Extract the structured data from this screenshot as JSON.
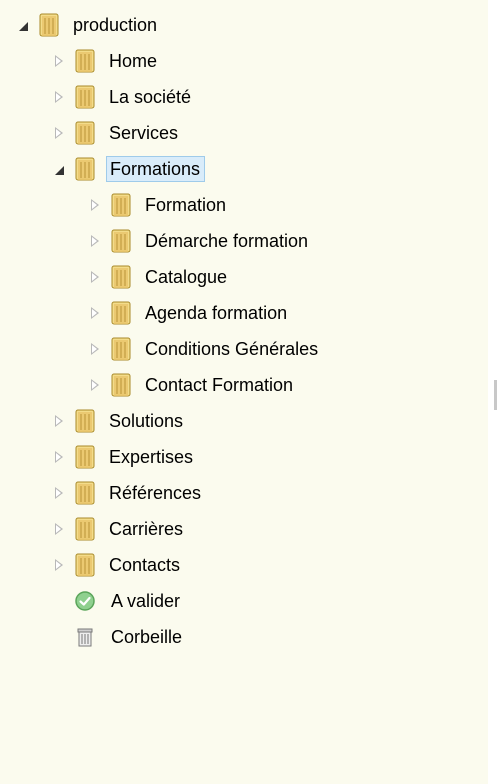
{
  "tree": {
    "root": {
      "label": "production",
      "state": "expanded"
    },
    "items": [
      {
        "label": "Home",
        "state": "collapsed"
      },
      {
        "label": "La société",
        "state": "collapsed"
      },
      {
        "label": "Services",
        "state": "collapsed"
      },
      {
        "label": "Formations",
        "state": "expanded",
        "selected": true,
        "children": [
          {
            "label": "Formation",
            "state": "collapsed"
          },
          {
            "label": "Démarche formation",
            "state": "collapsed"
          },
          {
            "label": "Catalogue",
            "state": "collapsed"
          },
          {
            "label": "Agenda formation",
            "state": "collapsed"
          },
          {
            "label": "Conditions Générales",
            "state": "collapsed"
          },
          {
            "label": "Contact Formation",
            "state": "collapsed"
          }
        ]
      },
      {
        "label": "Solutions",
        "state": "collapsed"
      },
      {
        "label": "Expertises",
        "state": "collapsed"
      },
      {
        "label": "Références",
        "state": "collapsed"
      },
      {
        "label": "Carrières",
        "state": "collapsed"
      },
      {
        "label": "Contacts",
        "state": "collapsed"
      }
    ],
    "special": [
      {
        "label": "A valider",
        "icon": "check-circle-icon"
      },
      {
        "label": "Corbeille",
        "icon": "trash-icon"
      }
    ]
  },
  "colors": {
    "panel_background": "#fbfbee",
    "selection_background": "#d9ecfa",
    "selection_border": "#9fcbea",
    "folder_fill": "#e8c46a",
    "check_green": "#6cc06c"
  }
}
